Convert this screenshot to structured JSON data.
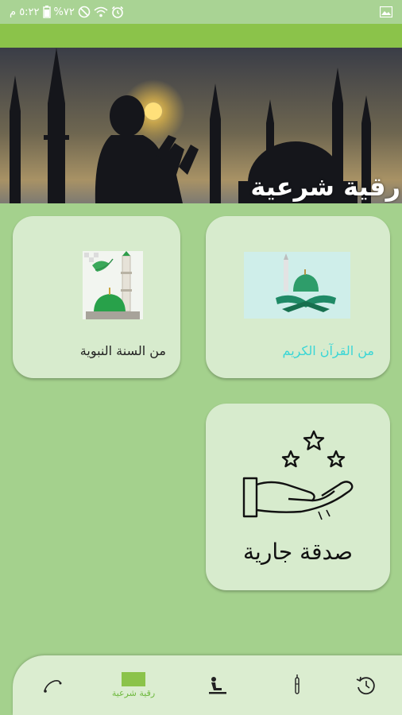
{
  "status_bar": {
    "time": "٥:٢٢ م",
    "battery": "%٧٢"
  },
  "banner": {
    "title": "رقية شرعية"
  },
  "cards": {
    "quran_label": "من القرآن الكريم",
    "sunnah_label": "من السنة النبوية",
    "sadaqa_label": "صدقة جارية"
  },
  "bottom_nav": {
    "active_label": "رقية شرعية"
  },
  "colors": {
    "background": "#a4d18d",
    "accent": "#8bc34a",
    "card": "#d7ebcd",
    "quran_label": "#3ad6d6"
  },
  "icons": [
    "alarm-icon",
    "wifi-icon",
    "dnd-icon",
    "battery-icon",
    "image-icon",
    "star-icon",
    "hand-icon",
    "history-icon",
    "prayer-beads-icon",
    "prayer-icon",
    "tasbih-icon"
  ]
}
